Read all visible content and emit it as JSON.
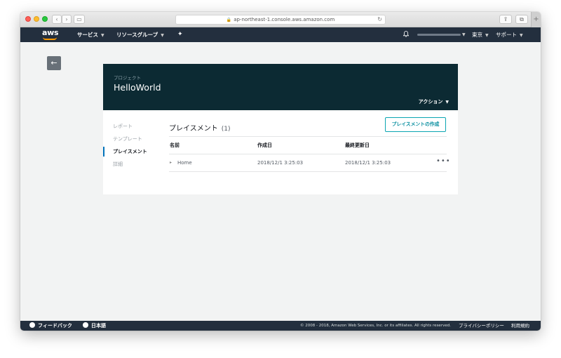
{
  "browser": {
    "url": "ap-northeast-1.console.aws.amazon.com"
  },
  "aws_nav": {
    "logo": "aws",
    "services": "サービス",
    "resource_groups": "リソースグループ",
    "region": "東京",
    "support": "サポート"
  },
  "project": {
    "kicker": "プロジェクト",
    "title": "HelloWorld",
    "action": "アクション"
  },
  "sidebar": {
    "items": [
      {
        "label": "レポート"
      },
      {
        "label": "テンプレート"
      },
      {
        "label": "プレイスメント"
      },
      {
        "label": "詳細"
      }
    ],
    "active_index": 2
  },
  "placements": {
    "title": "プレイスメント",
    "count": "(1)",
    "create_button": "プレイスメントの作成",
    "columns": [
      "名前",
      "作成日",
      "最終更新日"
    ],
    "rows": [
      {
        "name": "Home",
        "created": "2018/12/1 3:25:03",
        "updated": "2018/12/1 3:25:03",
        "more": "•••"
      }
    ]
  },
  "footer": {
    "feedback": "フィードバック",
    "language": "日本語",
    "copyright": "© 2008 - 2018, Amazon Web Services, Inc. or its affiliates. All rights reserved.",
    "privacy": "プライバシーポリシー",
    "terms": "利用規約"
  },
  "colors": {
    "nav_bg": "#232f3e",
    "header_bg": "#0c2a33",
    "accent": "#0073bb",
    "button_border": "#0aa5b2",
    "logo_smile": "#ff9900"
  }
}
